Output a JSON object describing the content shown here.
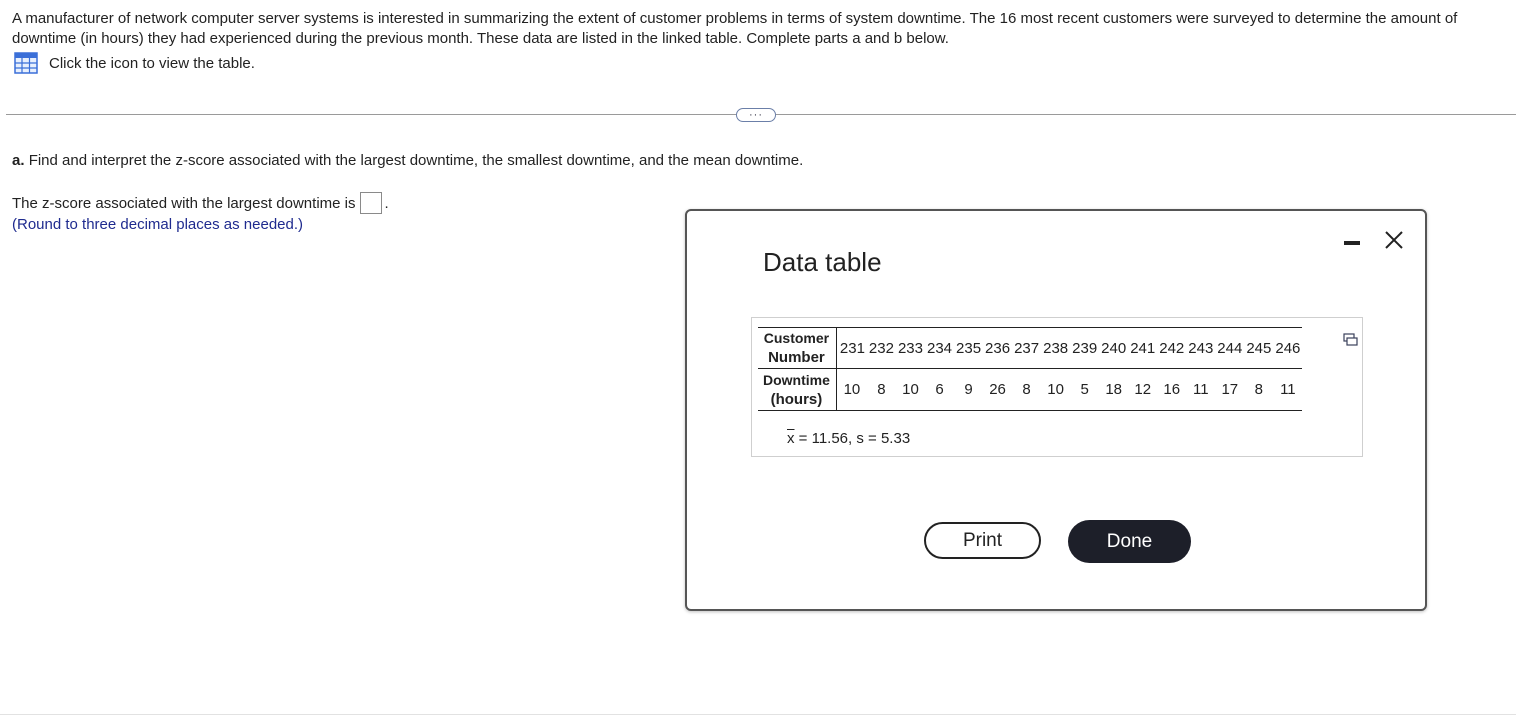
{
  "problem": {
    "text": "A manufacturer of network computer server systems is interested in summarizing the extent of customer problems in terms of system downtime. The 16 most recent customers were surveyed to determine the amount of downtime (in hours) they had experienced during the previous month. These data are listed in the linked table. Complete parts a and b below.",
    "table_link": {
      "icon": "table-grid-icon",
      "label": "Click the icon to view the table."
    }
  },
  "expand_button": {
    "label": "···"
  },
  "part_a": {
    "prefix": "a.",
    "question": "Find and interpret the z-score associated with the largest downtime, the smallest downtime, and the mean downtime.",
    "answer_prompt": "The z-score associated with the largest downtime is",
    "answer_value": "",
    "round_note": "(Round to three decimal places as needed.)"
  },
  "modal": {
    "title": "Data table",
    "minimize_icon": "minimize-icon",
    "close_icon": "close-icon",
    "copy_icon": "copy-icon",
    "table": {
      "row1_head_line1": "Customer",
      "row1_head_line2": "Number",
      "row2_head_line1": "Downtime",
      "row2_head_line2": "(hours)",
      "customers": [
        "231",
        "232",
        "233",
        "234",
        "235",
        "236",
        "237",
        "238",
        "239",
        "240",
        "241",
        "242",
        "243",
        "244",
        "245",
        "246"
      ],
      "downtimes": [
        "10",
        "8",
        "10",
        "6",
        "9",
        "26",
        "8",
        "10",
        "5",
        "18",
        "12",
        "16",
        "11",
        "17",
        "8",
        "11"
      ]
    },
    "stats": {
      "xbar_symbol": "x",
      "xbar_value": "= 11.56,",
      "s_label": "s = 5.33"
    },
    "print_label": "Print",
    "done_label": "Done"
  },
  "colors": {
    "note_blue": "#1f2b8f",
    "done_bg": "#1d1f29",
    "icon_blue": "#3a6fd8"
  }
}
